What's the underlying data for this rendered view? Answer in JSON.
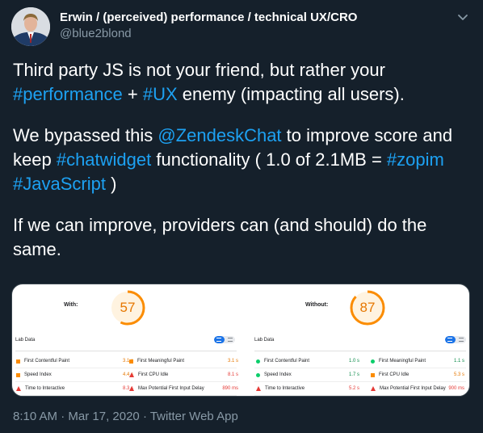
{
  "header": {
    "display_name": "Erwin / (perceived) performance / technical UX/CRO",
    "handle": "@blue2blond"
  },
  "text": {
    "p1_a": "Third party JS is not your friend, but rather your ",
    "p1_tag1": "#performance",
    "p1_b": " + ",
    "p1_tag2": "#UX",
    "p1_c": " enemy (impacting all users).",
    "p2_a": "We bypassed this ",
    "p2_mention": "@ZendeskChat",
    "p2_b": " to improve score and keep ",
    "p2_tag1": "#chatwidget",
    "p2_c": " functionality ( 1.0 of 2.1MB = ",
    "p2_tag2": "#zopim",
    "p2_tag3": "#JavaScript",
    "p2_d": " )",
    "p3": "If we can improve, providers can (and should) do the same."
  },
  "media": {
    "left": {
      "label": "With:",
      "score": "57",
      "score_fraction": 0.57,
      "lab_title": "Lab Data",
      "metrics": [
        {
          "name": "First Contentful Paint",
          "value": "3.1 s",
          "marker": "square"
        },
        {
          "name": "First Meaningful Paint",
          "value": "3.1 s",
          "marker": "square"
        },
        {
          "name": "Speed Index",
          "value": "4.4 s",
          "marker": "square"
        },
        {
          "name": "First CPU Idle",
          "value": "8.1 s",
          "marker": "triangle"
        },
        {
          "name": "Time to Interactive",
          "value": "8.3 s",
          "marker": "triangle"
        },
        {
          "name": "Max Potential First Input Delay",
          "value": "890 ms",
          "marker": "triangle"
        }
      ]
    },
    "right": {
      "label": "Without:",
      "score": "87",
      "score_fraction": 0.87,
      "lab_title": "Lab Data",
      "metrics": [
        {
          "name": "First Contentful Paint",
          "value": "1.0 s",
          "marker": "circle"
        },
        {
          "name": "First Meaningful Paint",
          "value": "1.1 s",
          "marker": "circle"
        },
        {
          "name": "Speed Index",
          "value": "1.7 s",
          "marker": "circle"
        },
        {
          "name": "First CPU Idle",
          "value": "5.3 s",
          "marker": "square"
        },
        {
          "name": "Time to Interactive",
          "value": "5.2 s",
          "marker": "triangle"
        },
        {
          "name": "Max Potential First Input Delay",
          "value": "900 ms",
          "marker": "triangle"
        }
      ]
    }
  },
  "footer": {
    "time": "8:10 AM",
    "sep1": " · ",
    "date": "Mar 17, 2020",
    "sep2": " · ",
    "source": "Twitter Web App"
  },
  "colors": {
    "background": "#15202b",
    "link": "#1da1f2",
    "muted": "#8899a6",
    "good": "#0cce6b",
    "average": "#fb8c00",
    "poor": "#e53935"
  }
}
